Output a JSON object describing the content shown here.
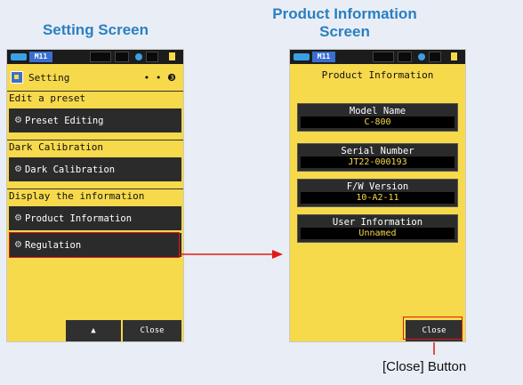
{
  "captions": {
    "left": "Setting Screen",
    "right_line1": "Product Information",
    "right_line2": "Screen",
    "close_button_label": "[Close] Button"
  },
  "status_bar": {
    "memory": "M11"
  },
  "setting_screen": {
    "title": "Setting",
    "page_indicator": "• • ❸",
    "sections": [
      {
        "header": "Edit a preset",
        "items": [
          "Preset Editing"
        ]
      },
      {
        "header": "Dark Calibration",
        "items": [
          "Dark Calibration"
        ]
      },
      {
        "header": "Display the information",
        "items": [
          "Product Information",
          "Regulation"
        ]
      }
    ],
    "up_button": "▲",
    "close_button": "Close"
  },
  "product_info_screen": {
    "title": "Product Information",
    "fields": [
      {
        "label": "Model Name",
        "value": "C-800"
      },
      {
        "label": "Serial Number",
        "value": "JT22-000193"
      },
      {
        "label": "F/W Version",
        "value": "10-A2-11"
      },
      {
        "label": "User Information",
        "value": "Unnamed"
      }
    ],
    "close_button": "Close"
  },
  "colors": {
    "caption_blue": "#2a7fc1",
    "screen_yellow": "#f7d94c",
    "highlight_red": "#e01818"
  }
}
